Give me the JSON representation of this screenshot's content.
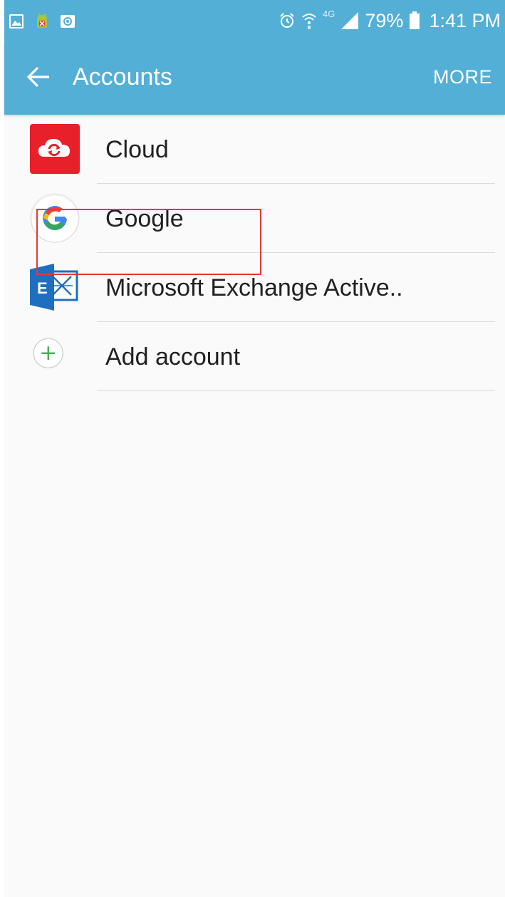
{
  "status_bar": {
    "battery": "79%",
    "time": "1:41 PM",
    "network": "4G"
  },
  "toolbar": {
    "title": "Accounts",
    "more_label": "MORE"
  },
  "accounts": [
    {
      "label": "Cloud",
      "icon": "cloud-icon"
    },
    {
      "label": "Google",
      "icon": "google-icon"
    },
    {
      "label": "Microsoft Exchange Active..",
      "icon": "exchange-icon"
    },
    {
      "label": "Add account",
      "icon": "add-icon"
    }
  ],
  "colors": {
    "accent": "#53afd6",
    "highlight": "#e53935"
  }
}
